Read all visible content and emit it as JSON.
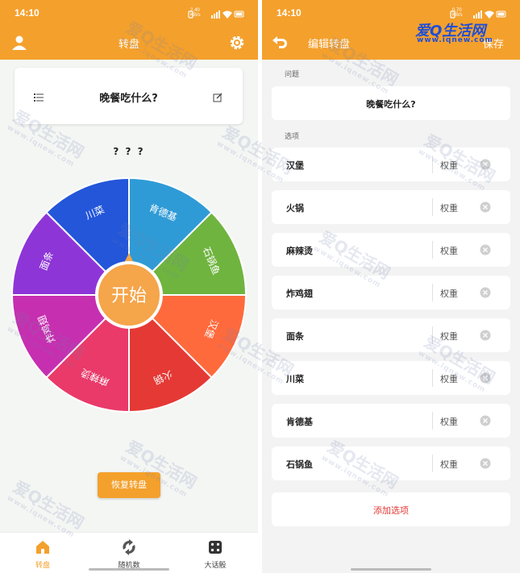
{
  "status_left": {
    "time": "14:10",
    "net_speed": "2.40",
    "net_unit": "KB/s"
  },
  "status_right": {
    "time": "14:10",
    "net_speed": "0.70",
    "net_unit": "KB/s"
  },
  "wheel_screen": {
    "title": "转盘",
    "question": "晚餐吃什么?",
    "result": "? ? ?",
    "start_label": "开始",
    "restore_label": "恢复转盘",
    "tabs": [
      {
        "label": "转盘",
        "icon": "home-icon",
        "active": true
      },
      {
        "label": "随机数",
        "icon": "refresh-icon",
        "active": false
      },
      {
        "label": "大话骰",
        "icon": "dice-icon",
        "active": false
      }
    ]
  },
  "wheel_segments": [
    {
      "label": "肯德基",
      "color": "#2f9bd6"
    },
    {
      "label": "石锅鱼",
      "color": "#6fb43f"
    },
    {
      "label": "汉堡",
      "color": "#ff6a3d"
    },
    {
      "label": "火锅",
      "color": "#e53935"
    },
    {
      "label": "麻辣烫",
      "color": "#e93a6a"
    },
    {
      "label": "炸鸡翅",
      "color": "#c62fb0"
    },
    {
      "label": "面条",
      "color": "#8e35d8"
    },
    {
      "label": "川菜",
      "color": "#2356d9"
    }
  ],
  "edit_screen": {
    "title": "编辑转盘",
    "save_label": "保存",
    "question_section": "问题",
    "question_value": "晚餐吃什么?",
    "options_section": "选项",
    "weight_placeholder": "权重",
    "options": [
      "汉堡",
      "火锅",
      "麻辣烫",
      "炸鸡翅",
      "面条",
      "川菜",
      "肯德基",
      "石锅鱼"
    ],
    "add_label": "添加选项"
  },
  "watermark": {
    "brand": "爱Q生活网",
    "url": "www.iqnew.com"
  },
  "colors": {
    "accent": "#f4a02c",
    "danger": "#e53935"
  }
}
